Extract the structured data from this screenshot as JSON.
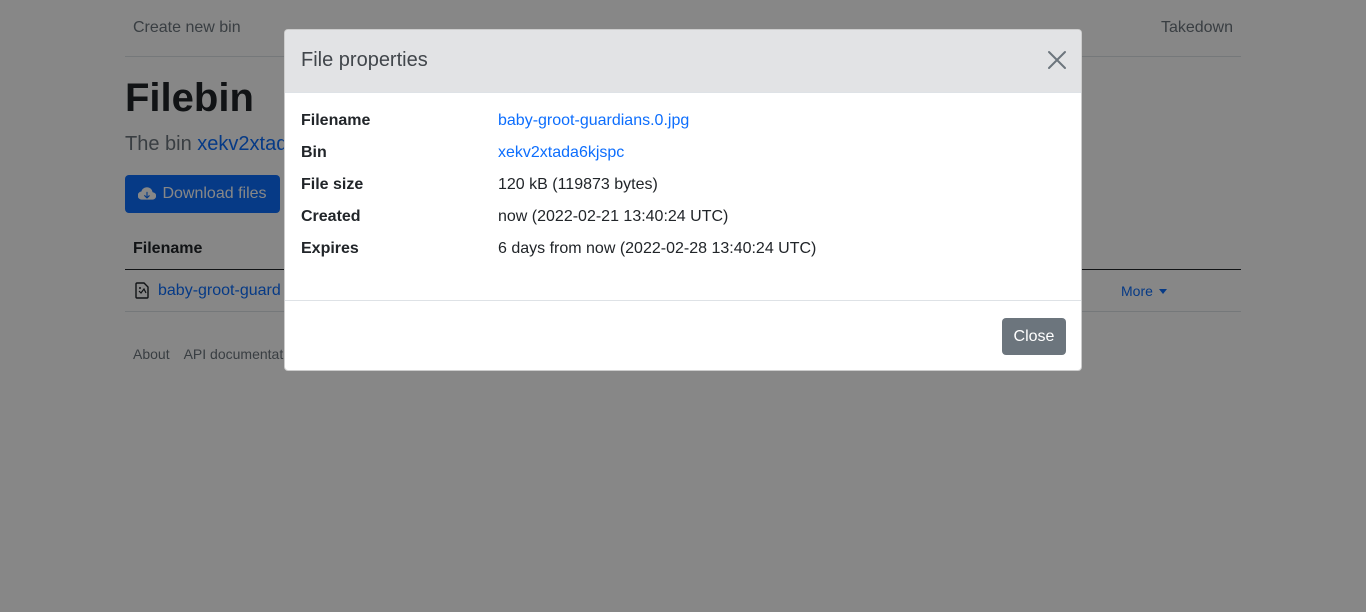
{
  "nav": {
    "create": "Create new bin",
    "takedown": "Takedown"
  },
  "page": {
    "title": "Filebin",
    "lead_prefix": "The bin ",
    "lead_bin": "xekv2xtada",
    "download_label": "Download files"
  },
  "table": {
    "header_filename": "Filename",
    "rows": [
      {
        "filename": "baby-groot-guard",
        "more_label": "More"
      }
    ]
  },
  "footer": {
    "about": "About",
    "api_docs": "API documentat"
  },
  "modal": {
    "title": "File properties",
    "properties": [
      {
        "label": "Filename",
        "value": "baby-groot-guardians.0.jpg",
        "link": true
      },
      {
        "label": "Bin",
        "value": "xekv2xtada6kjspc",
        "link": true
      },
      {
        "label": "File size",
        "value": "120 kB (119873 bytes)",
        "link": false
      },
      {
        "label": "Created",
        "value": "now (2022-02-21 13:40:24 UTC)",
        "link": false
      },
      {
        "label": "Expires",
        "value": "6 days from now (2022-02-28 13:40:24 UTC)",
        "link": false
      }
    ],
    "close_label": "Close"
  },
  "colors": {
    "primary": "#0d6efd",
    "secondary": "#6c757d",
    "modal_header_bg": "#e2e3e5"
  },
  "icons": {
    "download": "cloud-download-icon",
    "file": "file-icon",
    "close": "close-icon"
  }
}
